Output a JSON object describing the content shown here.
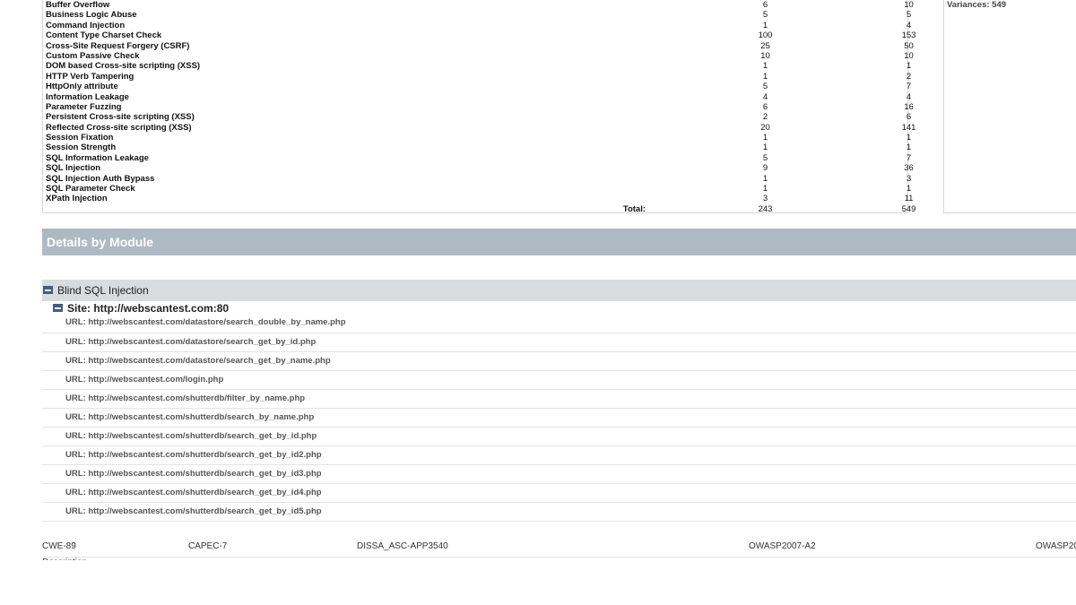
{
  "summary": {
    "rows": [
      {
        "name": "Buffer Overflow",
        "count": "6",
        "variances": "10"
      },
      {
        "name": "Business Logic Abuse",
        "count": "5",
        "variances": "5"
      },
      {
        "name": "Command Injection",
        "count": "1",
        "variances": "4"
      },
      {
        "name": "Content Type Charset Check",
        "count": "100",
        "variances": "153"
      },
      {
        "name": "Cross-Site Request Forgery (CSRF)",
        "count": "25",
        "variances": "50"
      },
      {
        "name": "Custom Passive Check",
        "count": "10",
        "variances": "10"
      },
      {
        "name": "DOM based Cross-site scripting (XSS)",
        "count": "1",
        "variances": "1"
      },
      {
        "name": "HTTP Verb Tampering",
        "count": "1",
        "variances": "2"
      },
      {
        "name": "HttpOnly attribute",
        "count": "5",
        "variances": "7"
      },
      {
        "name": "Information Leakage",
        "count": "4",
        "variances": "4"
      },
      {
        "name": "Parameter Fuzzing",
        "count": "6",
        "variances": "16"
      },
      {
        "name": "Persistent Cross-site scripting (XSS)",
        "count": "2",
        "variances": "6"
      },
      {
        "name": "Reflected Cross-site scripting (XSS)",
        "count": "20",
        "variances": "141"
      },
      {
        "name": "Session Fixation",
        "count": "1",
        "variances": "1"
      },
      {
        "name": "Session Strength",
        "count": "1",
        "variances": "1"
      },
      {
        "name": "SQL Information Leakage",
        "count": "5",
        "variances": "7"
      },
      {
        "name": "SQL Injection",
        "count": "9",
        "variances": "36"
      },
      {
        "name": "SQL Injection Auth Bypass",
        "count": "1",
        "variances": "3"
      },
      {
        "name": "SQL Parameter Check",
        "count": "1",
        "variances": "1"
      },
      {
        "name": "XPath Injection",
        "count": "3",
        "variances": "11"
      }
    ],
    "total_label": "Total:",
    "total_count": "243",
    "total_variances": "549",
    "side_variances": "Variances: 549"
  },
  "module_header": "Details by Module",
  "group": {
    "title": "Blind SQL Injection",
    "site": "Site: http://webscantest.com:80",
    "urls": [
      "URL: http://webscantest.com/datastore/search_double_by_name.php",
      "URL: http://webscantest.com/datastore/search_get_by_id.php",
      "URL: http://webscantest.com/datastore/search_get_by_name.php",
      "URL: http://webscantest.com/login.php",
      "URL: http://webscantest.com/shutterdb/filter_by_name.php",
      "URL: http://webscantest.com/shutterdb/search_by_name.php",
      "URL: http://webscantest.com/shutterdb/search_get_by_id.php",
      "URL: http://webscantest.com/shutterdb/search_get_by_id2.php",
      "URL: http://webscantest.com/shutterdb/search_get_by_id3.php",
      "URL: http://webscantest.com/shutterdb/search_get_by_id4.php",
      "URL: http://webscantest.com/shutterdb/search_get_by_id5.php"
    ]
  },
  "references": [
    "CWE-89",
    "CAPEC-7",
    "DISSA_ASC-APP3540",
    "OWASP2007-A2",
    "OWASP20"
  ],
  "cutoff_text": "Description"
}
